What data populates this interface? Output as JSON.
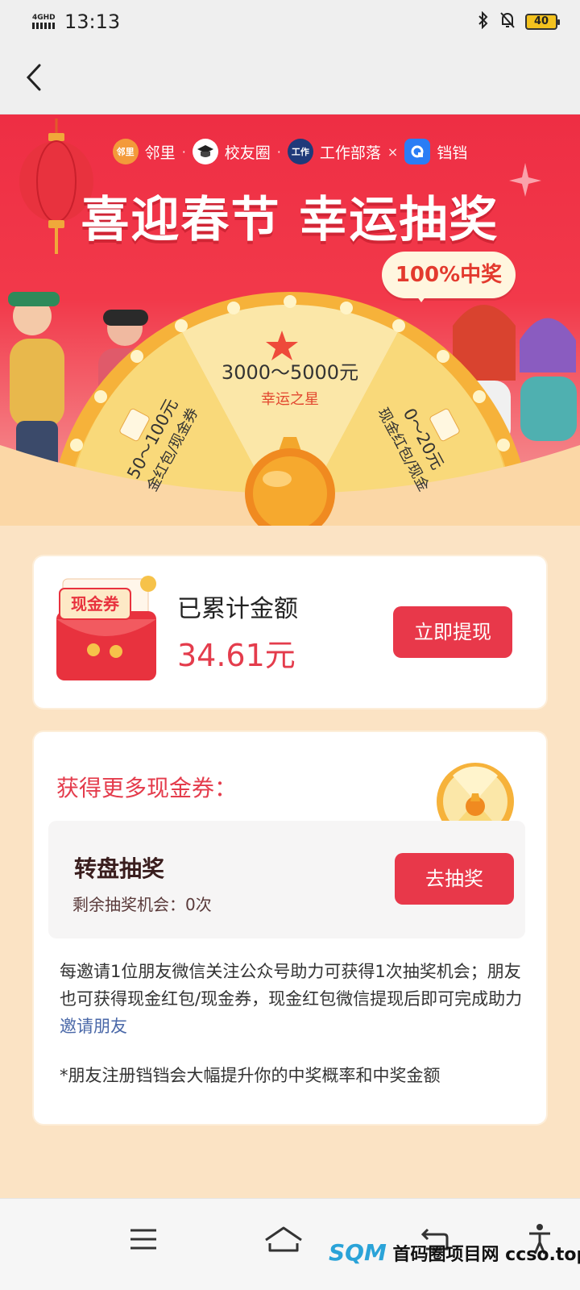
{
  "status": {
    "network": "4GHD",
    "time": "13:13",
    "battery": "40"
  },
  "banner": {
    "partners": [
      {
        "name": "邻里",
        "logo_text": "邻里"
      },
      {
        "name": "校友圈",
        "logo_text": ""
      },
      {
        "name": "工作部落",
        "logo_text": "工作"
      }
    ],
    "cross": "×",
    "brand": "铛铛",
    "headline": "喜迎春节 幸运抽奖",
    "badge": "100%中奖",
    "wheel": {
      "top_amount": "3000～5000元",
      "top_label": "幸运之星",
      "left_amount": "50～100元",
      "left_label": "金红包/现金券",
      "right_amount": "0～20元",
      "right_label": "现金红包/现金"
    }
  },
  "balance": {
    "coupon_label": "现金券",
    "label": "已累计金额",
    "amount": "34.61元",
    "withdraw_button": "立即提现"
  },
  "more": {
    "title": "获得更多现金券：",
    "task_title": "转盘抽奖",
    "task_sub": "剩余抽奖机会：0次",
    "draw_button": "去抽奖",
    "description": "每邀请1位朋友微信关注公众号助力可获得1次抽奖机会；朋友也可获得现金红包/现金券，现金红包微信提现后即可完成助力",
    "invite_link": "邀请朋友",
    "note": "*朋友注册铛铛会大幅提升你的中奖概率和中奖金额"
  },
  "watermark": {
    "logo": "SQM",
    "text": "首码圈项目网 ccso.top"
  },
  "colors": {
    "accent_red": "#e8384a",
    "banner_red": "#ee2e44",
    "amount_red": "#e43c4c",
    "wheel_gold": "#f6b23a",
    "background": "#fbe3c4"
  },
  "icons": [
    "back-arrow-icon",
    "bluetooth-icon",
    "bell-off-icon",
    "menu-icon",
    "home-icon",
    "return-icon",
    "accessibility-icon"
  ]
}
